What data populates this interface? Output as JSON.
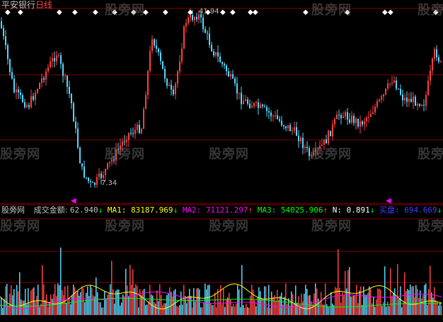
{
  "header": {
    "stock_name": "平安银行",
    "period": "日线"
  },
  "price_panel": {
    "high_label": "41.94",
    "low_label": "7.34",
    "up_color": "#ff4040",
    "down_color": "#54d7ff",
    "ma_color": "#ffffff"
  },
  "indicator_bar": {
    "watermark": "股旁网",
    "title": "成交金额",
    "value": "62.940",
    "ma1_label": "MA1:",
    "ma1_value": "83187.969",
    "ma2_label": "MA2:",
    "ma2_value": "71121.297",
    "ma3_label": "MA3:",
    "ma3_value": "54025.906",
    "n_label": "N:",
    "n_value": "0.891",
    "buy_label": "买盘:",
    "buy_value": "694.669"
  },
  "watermarks": [
    "股旁网"
  ],
  "colors": {
    "background": "#000000",
    "grid": "#800000",
    "ma1": "#ffff00",
    "ma2": "#ff00ff",
    "ma3": "#00ff00",
    "n": "#ffffff",
    "buy": "#4040ff",
    "arrow_up": "#ff4040",
    "arrow_down": "#00ff00"
  }
}
